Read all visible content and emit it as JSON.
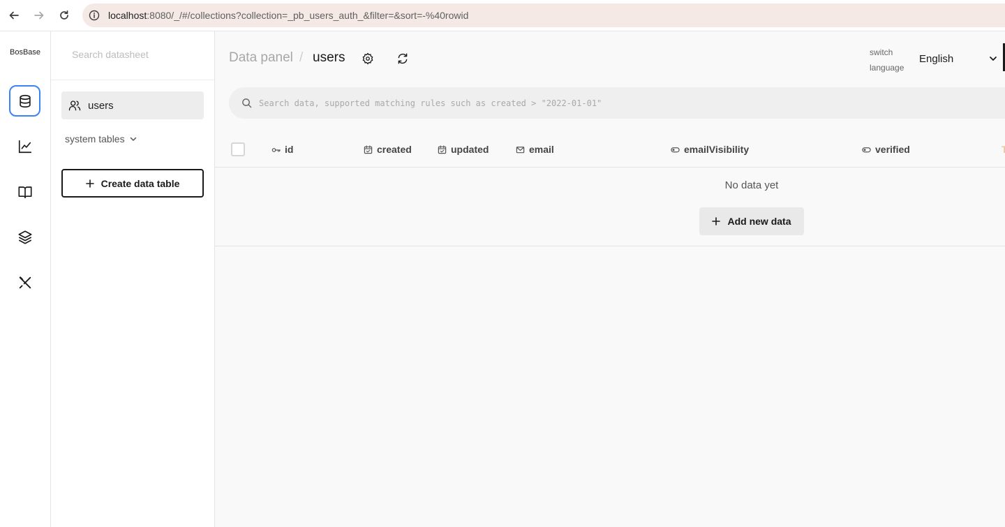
{
  "browser": {
    "url_host": "localhost",
    "url_rest": ":8080/_/#/collections?collection=_pb_users_auth_&filter=&sort=-%40rowid"
  },
  "rail": {
    "brand": "BosBase",
    "items": [
      {
        "icon": "database-icon",
        "active": true
      },
      {
        "icon": "chart-icon",
        "active": false
      },
      {
        "icon": "book-icon",
        "active": false
      },
      {
        "icon": "layers-icon",
        "active": false
      },
      {
        "icon": "tools-icon",
        "active": false
      }
    ]
  },
  "sidebar": {
    "search_placeholder": "Search datasheet",
    "collection_label": "users",
    "system_tables_label": "system tables",
    "create_label": "Create data table"
  },
  "main": {
    "breadcrumb_root": "Data panel",
    "breadcrumb_separator": "/",
    "breadcrumb_current": "users",
    "switch_language_label": "switch language",
    "language": "English",
    "search_placeholder": "Search data, supported matching rules such as created > \"2022-01-01\"",
    "columns": [
      {
        "label": "id",
        "icon": "key-icon"
      },
      {
        "label": "created",
        "icon": "calendar-icon"
      },
      {
        "label": "updated",
        "icon": "calendar-icon"
      },
      {
        "label": "email",
        "icon": "mail-icon"
      },
      {
        "label": "emailVisibility",
        "icon": "toggle-icon"
      },
      {
        "label": "verified",
        "icon": "toggle-icon"
      }
    ],
    "empty_text": "No data yet",
    "add_label": "Add new data"
  }
}
